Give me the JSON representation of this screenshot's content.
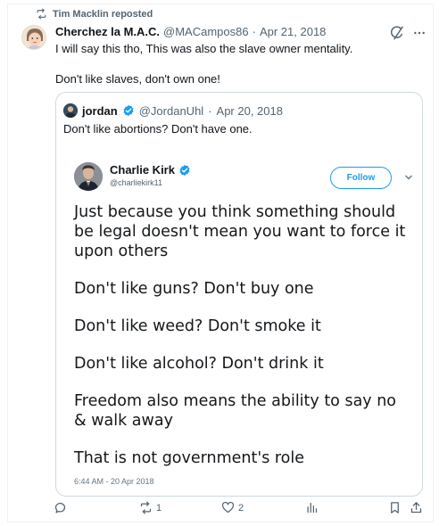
{
  "repost": {
    "label": "Tim Macklin reposted",
    "icon": "repost-icon"
  },
  "post": {
    "author_name": "Cherchez la M.A.C.",
    "author_handle": "@MACampos86",
    "separator": "·",
    "date": "Apr 21, 2018",
    "line1": "I will say this tho, This was also the slave owner mentality.",
    "line2": "Don't like slaves, don't own one!"
  },
  "quote": {
    "author_name": "jordan",
    "author_handle": "@JordanUhl",
    "separator": "·",
    "date": "Apr 20, 2018",
    "text": "Don't like abortions? Don't have one."
  },
  "embed": {
    "author_name": "Charlie Kirk",
    "author_handle": "@charliekirk11",
    "follow_label": "Follow",
    "lines": [
      "Just because you think something should be legal doesn't mean you want to force it upon others",
      "Don't like guns? Don't buy one",
      "Don't like weed? Don't smoke it",
      "Don't like alcohol? Don't drink it",
      "Freedom also means the ability to say no & walk away",
      "That is not government's role"
    ],
    "timestamp": "6:44 AM - 20 Apr 2018"
  },
  "actions": {
    "reply_count": "",
    "repost_count": "1",
    "like_count": "2",
    "views_count": ""
  },
  "colors": {
    "accent": "#1d9bf0",
    "muted": "#536471",
    "text": "#0f1419",
    "border": "#cfd9de"
  }
}
